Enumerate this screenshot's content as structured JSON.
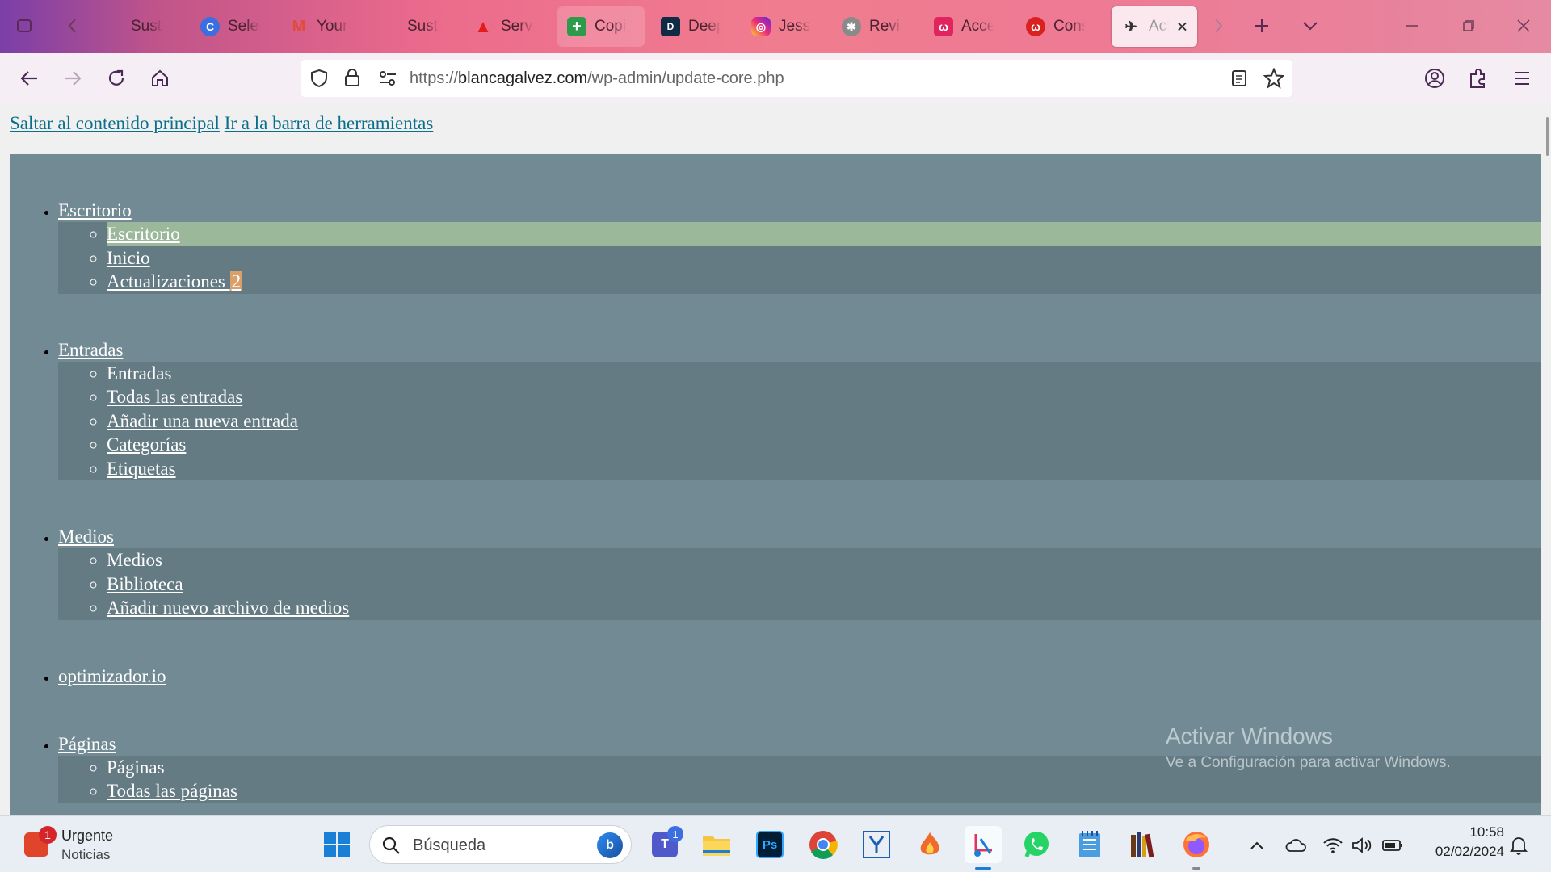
{
  "browser": {
    "tabs": [
      {
        "label": "Susta",
        "icon": "blank-icon",
        "color": ""
      },
      {
        "label": "Select",
        "icon": "copyleaks-icon",
        "color": "#3b6ee0"
      },
      {
        "label": "Your e",
        "icon": "gmail-icon",
        "color": "#e24a3b"
      },
      {
        "label": "Susta",
        "icon": "blank-icon",
        "color": ""
      },
      {
        "label": "Servic",
        "icon": "adobe-icon",
        "color": "#e21b1b"
      },
      {
        "label": "Copia",
        "icon": "sheets-plus-icon",
        "color": "#2d9b4a"
      },
      {
        "label": "Deepl",
        "icon": "deepl-icon",
        "color": "#0f2b46"
      },
      {
        "label": "Jessie",
        "icon": "instagram-icon",
        "color": "#d62976"
      },
      {
        "label": "Revisi",
        "icon": "openai-icon",
        "color": "#6a6a6a"
      },
      {
        "label": "Acces",
        "icon": "w-letter-icon",
        "color": "#e0245e"
      },
      {
        "label": "Consu",
        "icon": "w-letter-icon",
        "color": "#d9221f"
      },
      {
        "label": "Act",
        "icon": "bird-icon",
        "color": "#333"
      }
    ],
    "url_scheme": "https://",
    "url_domain": "blancagalvez.com",
    "url_path": "/wp-admin/update-core.php"
  },
  "page": {
    "skip_main": "Saltar al contenido principal",
    "skip_toolbar": "Ir a la barra de herramientas",
    "menu": {
      "escritorio": {
        "title": "Escritorio",
        "items": [
          "Escritorio",
          "Inicio"
        ],
        "updates_label": "Actualizaciones",
        "updates_count": "2"
      },
      "entradas": {
        "title": "Entradas",
        "header": "Entradas",
        "items": [
          "Todas las entradas",
          "Añadir una nueva entrada",
          "Categorías",
          "Etiquetas"
        ]
      },
      "medios": {
        "title": "Medios",
        "header": "Medios",
        "items": [
          "Biblioteca",
          "Añadir nuevo archivo de medios"
        ]
      },
      "optimizador": {
        "title": "optimizador.io"
      },
      "paginas": {
        "title": "Páginas",
        "header": "Páginas",
        "items": [
          "Todas las páginas"
        ]
      }
    },
    "watermark_title": "Activar Windows",
    "watermark_sub": "Ve a Configuración para activar Windows."
  },
  "taskbar": {
    "widget_title": "Urgente",
    "widget_sub": "Noticias",
    "widget_badge": "1",
    "search_placeholder": "Búsqueda",
    "teams_badge": "1",
    "time": "10:58",
    "date": "02/02/2024"
  }
}
